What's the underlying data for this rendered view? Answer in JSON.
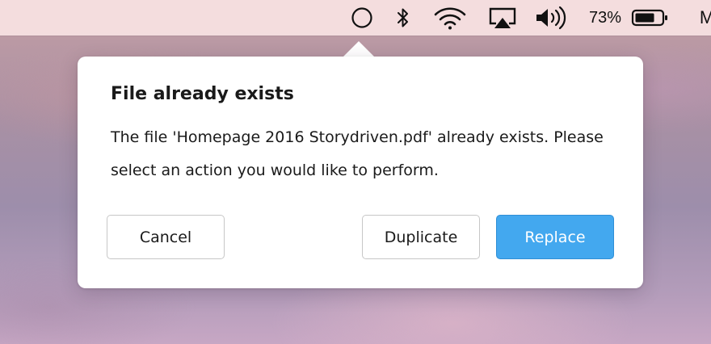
{
  "menubar": {
    "icons": [
      "status-circle-icon",
      "bluetooth-icon",
      "wifi-icon",
      "airplay-icon",
      "volume-icon",
      "battery-icon"
    ],
    "battery_percent": "73%",
    "trailing_text": "M"
  },
  "dialog": {
    "title": "File already exists",
    "message": "The file 'Homepage 2016 Storydriven.pdf' already exists. Please select an action you would like to perform.",
    "buttons": {
      "cancel": "Cancel",
      "duplicate": "Duplicate",
      "replace": "Replace"
    },
    "colors": {
      "primary_button": "#43a8ef",
      "primary_button_text": "#ffffff"
    }
  }
}
